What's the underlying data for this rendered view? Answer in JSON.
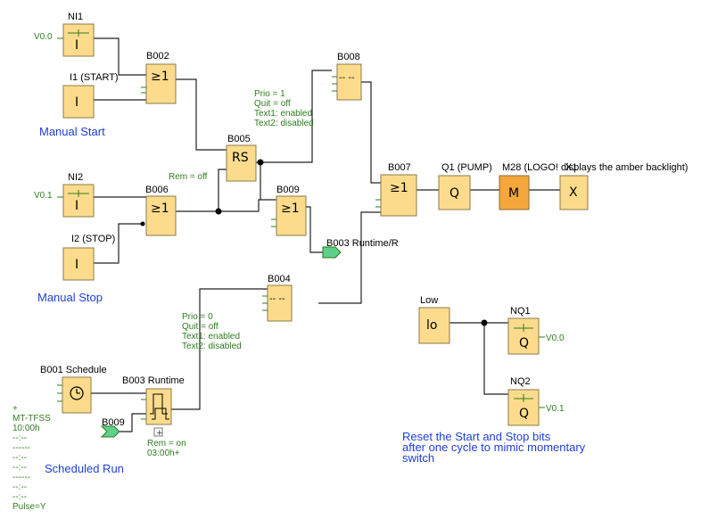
{
  "blocks": {
    "ni1": {
      "name": "NI1",
      "param": "V0.0",
      "symbol": "I"
    },
    "i1": {
      "name": "I1 (START)",
      "symbol": "I"
    },
    "b002": {
      "name": "B002",
      "symbol": "≥1"
    },
    "ni2": {
      "name": "NI2",
      "param": "V0.1",
      "symbol": "I"
    },
    "i2": {
      "name": "I2 (STOP)",
      "symbol": "I"
    },
    "b006": {
      "name": "B006",
      "symbol": "≥1"
    },
    "b005": {
      "name": "B005",
      "symbol": "RS",
      "rem": "Rem = off"
    },
    "b008": {
      "name": "B008",
      "symbol": "-- --",
      "params": [
        "Prio = 1",
        "Quit = off",
        "Text1: enabled",
        "Text2: disabled"
      ]
    },
    "b009": {
      "name": "B009",
      "symbol": "≥1"
    },
    "b003_flag": {
      "text": "B003 Runtime/R"
    },
    "b007": {
      "name": "B007",
      "symbol": "≥1"
    },
    "q1": {
      "name": "Q1 (PUMP)",
      "symbol": "Q"
    },
    "m28": {
      "name": "M28 (LOGO! displays the amber backlight)",
      "symbol": "M"
    },
    "x1": {
      "name": "X1",
      "symbol": "X"
    },
    "b004": {
      "name": "B004",
      "symbol": "-- --",
      "params": [
        "Prio = 0",
        "Quit = off",
        "Text1: enabled",
        "Text2: disabled"
      ]
    },
    "b001": {
      "name": "B001 Schedule",
      "params": [
        "+",
        "MT-TFSS",
        "10:00h",
        "--:--",
        "------",
        "--:--",
        "--:--",
        "------",
        "--:--",
        "--:--",
        "Pulse=Y"
      ]
    },
    "b003": {
      "name": "B003 Runtime",
      "rem": "Rem = on",
      "time": "03:00h+",
      "expand": "+"
    },
    "b009_flag": {
      "text": "B009"
    },
    "low": {
      "name": "Low",
      "symbol": "lo"
    },
    "nq1": {
      "name": "NQ1",
      "param": "V0.0",
      "symbol": "Q"
    },
    "nq2": {
      "name": "NQ2",
      "param": "V0.1",
      "symbol": "Q"
    }
  },
  "comments": {
    "manual_start": "Manual Start",
    "manual_stop": "Manual Stop",
    "scheduled_run": "Scheduled Run",
    "reset_note": [
      "Reset the Start and Stop bits",
      "after one cycle to mimic momentary",
      "switch"
    ]
  },
  "colors": {
    "block": "#fcdc8c",
    "marker": "#f6a73c",
    "param_text": "#2e7d1e",
    "comment_text": "#1f3fd6",
    "flag": "#5fcf8a"
  }
}
